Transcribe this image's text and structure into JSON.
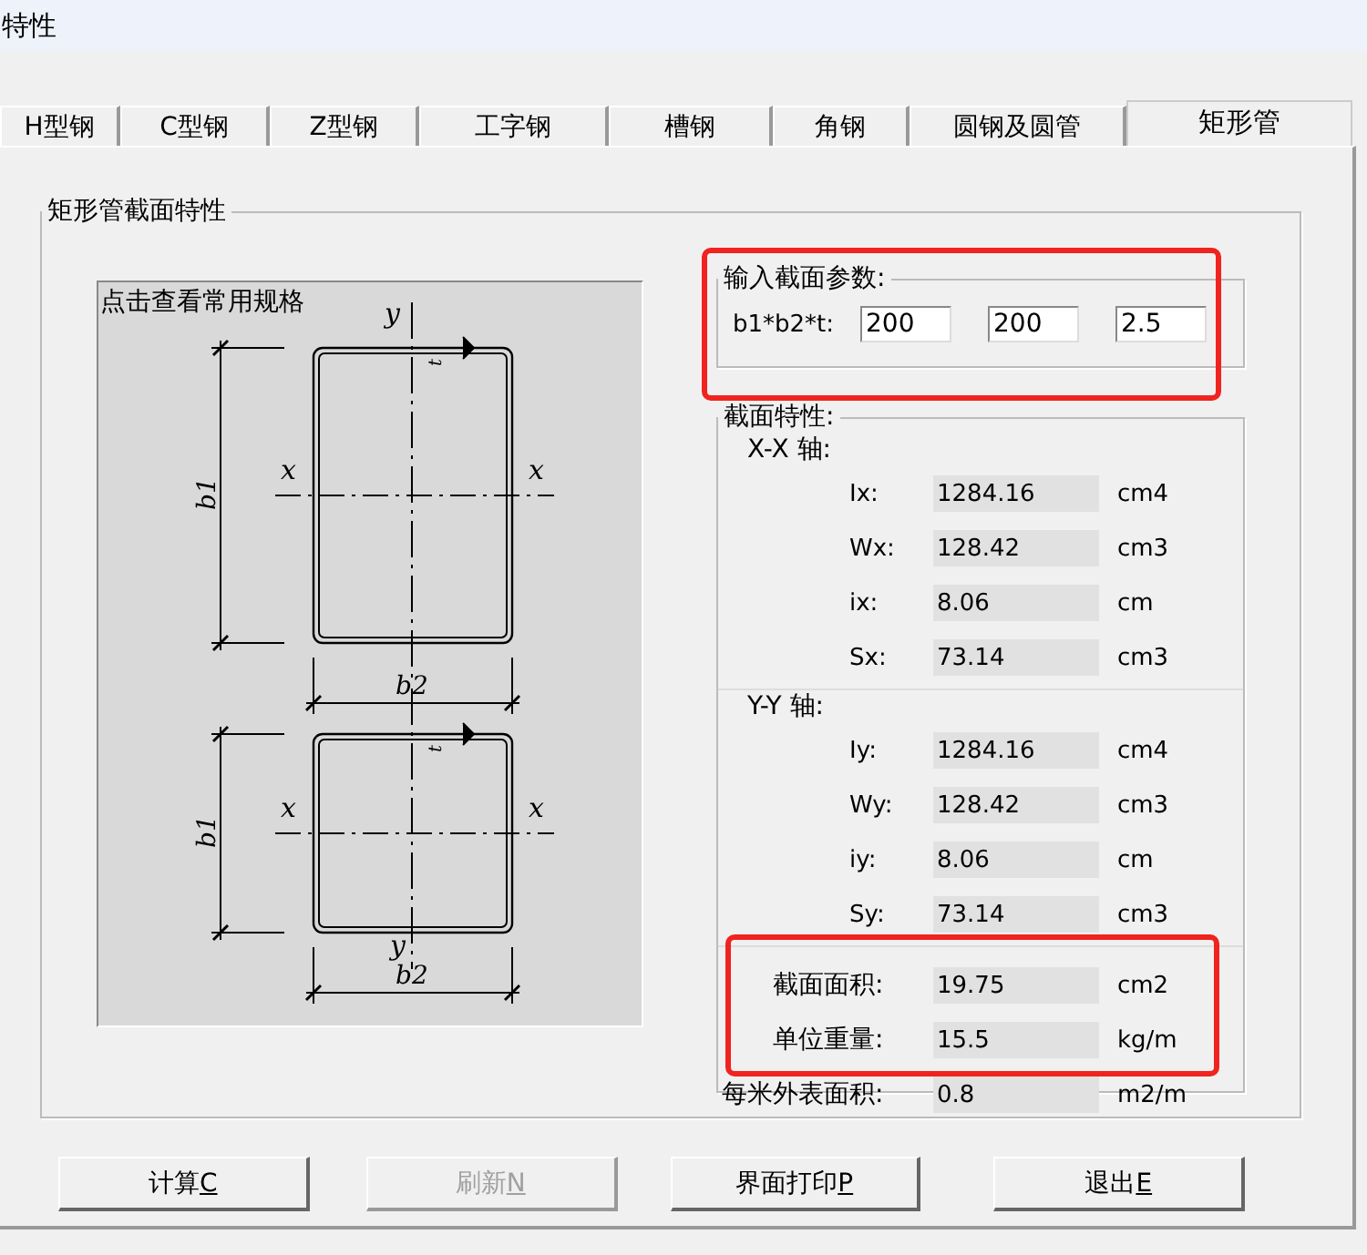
{
  "window": {
    "title": "特性"
  },
  "tabs": [
    {
      "label": "H型钢",
      "selected": false
    },
    {
      "label": "C型钢",
      "selected": false
    },
    {
      "label": "Z型钢",
      "selected": false
    },
    {
      "label": "工字钢",
      "selected": false
    },
    {
      "label": "槽钢",
      "selected": false
    },
    {
      "label": "角钢",
      "selected": false
    },
    {
      "label": "圆钢及圆管",
      "selected": false
    },
    {
      "label": "矩形管",
      "selected": true
    }
  ],
  "section_group": {
    "title": "矩形管截面特性"
  },
  "figure": {
    "caption": "点击查看常用规格",
    "sections": [
      {
        "axis_x_left": "x",
        "axis_x_right": "x",
        "axis_y": "y",
        "height_label": "b1",
        "width_label": "b2",
        "thickness_label": "t"
      },
      {
        "axis_x_left": "x",
        "axis_x_right": "x",
        "axis_y": "y",
        "height_label": "b1",
        "width_label": "b2",
        "thickness_label": "t"
      }
    ]
  },
  "input_group": {
    "title": "输入截面参数:",
    "highlighted": true,
    "label": "b1*b2*t:",
    "values": [
      "200",
      "200",
      "2.5"
    ]
  },
  "properties": {
    "title": "截面特性:",
    "axes": [
      {
        "title": "X-X 轴:",
        "rows": [
          {
            "label": "Ix:",
            "value": "1284.16",
            "unit": "cm4"
          },
          {
            "label": "Wx:",
            "value": "128.42",
            "unit": "cm3"
          },
          {
            "label": "ix:",
            "value": "8.06",
            "unit": "cm"
          },
          {
            "label": "Sx:",
            "value": "73.14",
            "unit": "cm3"
          }
        ]
      },
      {
        "title": "Y-Y 轴:",
        "rows": [
          {
            "label": "Iy:",
            "value": "1284.16",
            "unit": "cm4"
          },
          {
            "label": "Wy:",
            "value": "128.42",
            "unit": "cm3"
          },
          {
            "label": "iy:",
            "value": "8.06",
            "unit": "cm"
          },
          {
            "label": "Sy:",
            "value": "73.14",
            "unit": "cm3"
          }
        ]
      }
    ],
    "totals": {
      "highlighted": true,
      "rows": [
        {
          "label": "截面面积:",
          "value": "19.75",
          "unit": "cm2"
        },
        {
          "label": "单位重量:",
          "value": "15.5",
          "unit": "kg/m"
        }
      ]
    },
    "surface_row": {
      "label": "每米外表面积:",
      "value": "0.8",
      "unit": "m2/m"
    }
  },
  "buttons": [
    {
      "label": "计算",
      "key": "C",
      "disabled": false
    },
    {
      "label": "刷新",
      "key": "N",
      "disabled": true
    },
    {
      "label": "界面打印",
      "key": "P",
      "disabled": false
    },
    {
      "label": "退出",
      "key": "E",
      "disabled": false
    }
  ]
}
